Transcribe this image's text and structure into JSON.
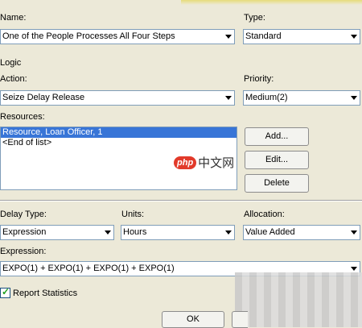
{
  "name": {
    "label": "Name:",
    "value": "One of the People Processes All Four Steps"
  },
  "type": {
    "label": "Type:",
    "value": "Standard"
  },
  "logic": {
    "label": "Logic"
  },
  "action": {
    "label": "Action:",
    "value": "Seize Delay Release"
  },
  "priority": {
    "label": "Priority:",
    "value": "Medium(2)"
  },
  "resources": {
    "label": "Resources:",
    "items": [
      "Resource, Loan Officer, 1",
      "<End of list>"
    ],
    "add_label": "Add...",
    "edit_label": "Edit...",
    "delete_label": "Delete"
  },
  "watermark": "中文网",
  "delay_type": {
    "label": "Delay Type:",
    "value": "Expression"
  },
  "units": {
    "label": "Units:",
    "value": "Hours"
  },
  "allocation": {
    "label": "Allocation:",
    "value": "Value Added"
  },
  "expression": {
    "label": "Expression:",
    "value": "EXPO(1) + EXPO(1) + EXPO(1) + EXPO(1)"
  },
  "report_stats": {
    "label": "Report Statistics",
    "checked": true
  },
  "footer": {
    "ok_label": "OK"
  },
  "colors": {
    "accent": "#3875d7",
    "background": "#ece9d8",
    "field_border": "#7f9db9"
  }
}
